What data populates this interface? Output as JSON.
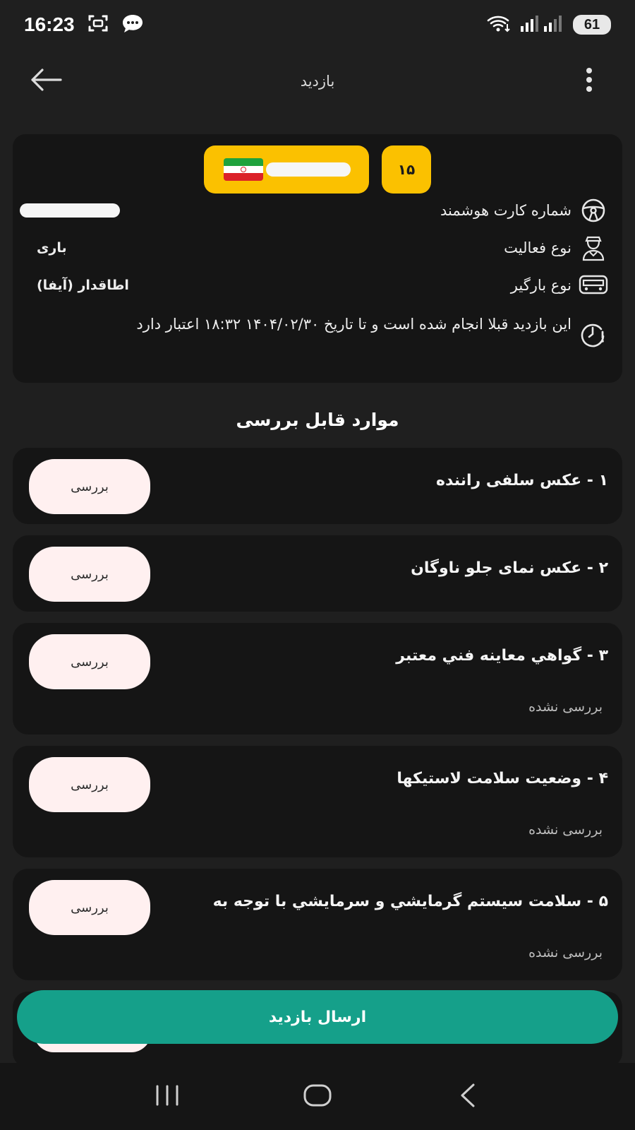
{
  "status_bar": {
    "time": "16:23",
    "battery": "61",
    "icons": [
      "screenshot-icon",
      "chat-icon",
      "wifi-icon",
      "signal-icon"
    ]
  },
  "app_bar": {
    "title": "بازدید",
    "back_icon": "arrow-left-icon",
    "more_icon": "more-vertical-icon"
  },
  "vehicle": {
    "plate_code": "۱۵",
    "smart_card_label": "شماره کارت هوشمند",
    "activity_label": "نوع فعالیت",
    "activity_value": "باری",
    "vehicle_type_label": "نوع بارگیر",
    "vehicle_type_value": "اطاقدار (آیفا)",
    "notice": "این بازدید قبلا انجام شده است و تا تاریخ ۱۴۰۴/۰۲/۳۰ ۱۸:۳۲ اعتبار دارد"
  },
  "section_title": "موارد قابل بررسی",
  "items": [
    {
      "title": "۱ - عکس سلفی راننده",
      "button": "بررسی",
      "status": ""
    },
    {
      "title": "۲ - عکس نمای جلو ناوگان",
      "button": "بررسی",
      "status": ""
    },
    {
      "title": "۳ - گواهي معاينه فني معتبر",
      "button": "بررسی",
      "status": "بررسی نشده"
    },
    {
      "title": "۴ - وضعیت سلامت لاستیکها",
      "button": "بررسی",
      "status": "بررسی نشده"
    },
    {
      "title": "۵ - سلامت سيستم گرمايشي و سرمايشي با توجه به",
      "button": "بررسی",
      "status": "بررسی نشده"
    }
  ],
  "submit_label": "ارسال بازدید",
  "nav_bar": {
    "icons": [
      "recent-apps-icon",
      "home-icon",
      "back-nav-icon"
    ]
  },
  "colors": {
    "background": "#1f1f1f",
    "card": "#151515",
    "plate": "#fbc100",
    "review_button": "#fff0f0",
    "submit": "#15a08a"
  }
}
